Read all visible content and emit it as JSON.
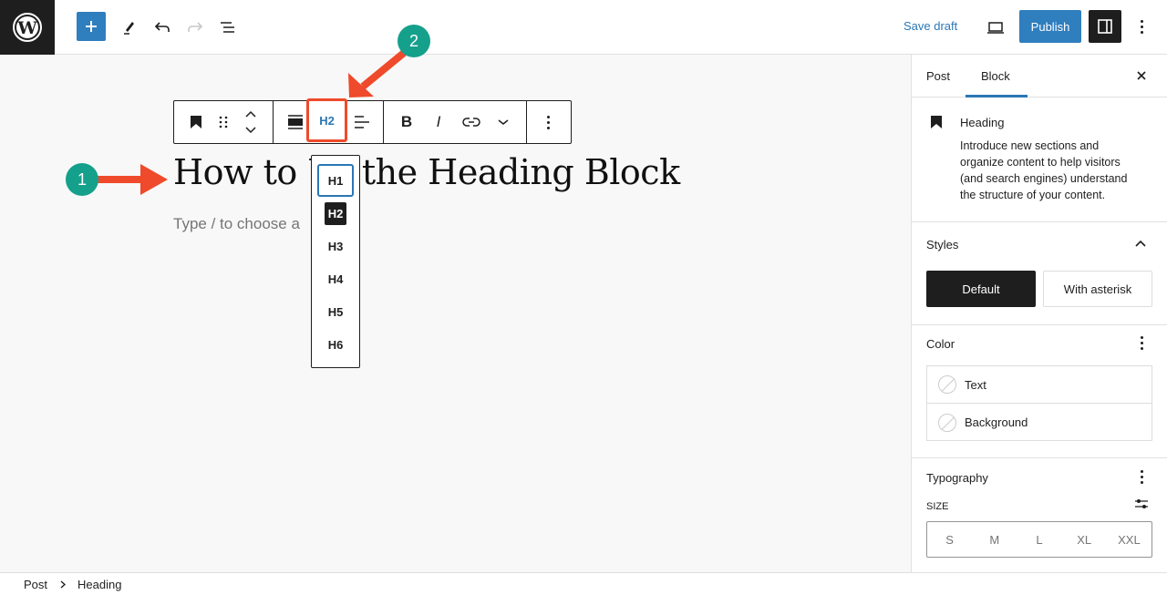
{
  "topbar": {
    "logo": "wordpress-logo",
    "add_block_label": "+",
    "save_draft": "Save draft",
    "publish": "Publish"
  },
  "block_toolbar": {
    "heading_level": "H2"
  },
  "editor": {
    "heading": "How to Use the Heading Block",
    "heading_visible_left": "How to U",
    "heading_visible_right": "the Heading Block",
    "placeholder": "Type / to choose a"
  },
  "heading_levels": [
    {
      "label": "H1",
      "state": "focused"
    },
    {
      "label": "H2",
      "state": "active"
    },
    {
      "label": "H3",
      "state": ""
    },
    {
      "label": "H4",
      "state": ""
    },
    {
      "label": "H5",
      "state": ""
    },
    {
      "label": "H6",
      "state": ""
    }
  ],
  "annotations": {
    "step1": "1",
    "step2": "2",
    "badge_color": "#15a08c",
    "arrow_color": "#ef4a2b"
  },
  "sidebar": {
    "tabs": [
      {
        "label": "Post",
        "active": false
      },
      {
        "label": "Block",
        "active": true
      }
    ],
    "block_card": {
      "title": "Heading",
      "description": "Introduce new sections and organize content to help visitors (and search engines) understand the structure of your content.",
      "desc_lines": [
        "Introduce new sections and",
        "organize content to help visitors",
        "(and search engines) understand",
        "the structure of your content."
      ]
    },
    "styles": {
      "title": "Styles",
      "options": [
        {
          "label": "Default",
          "selected": true
        },
        {
          "label": "With asterisk",
          "selected": false
        }
      ]
    },
    "color": {
      "title": "Color",
      "items": [
        "Text",
        "Background"
      ]
    },
    "typography": {
      "title": "Typography",
      "size_label": "SIZE",
      "sizes": [
        "S",
        "M",
        "L",
        "XL",
        "XXL"
      ]
    }
  },
  "footer": {
    "breadcrumb": [
      "Post",
      "Heading"
    ]
  },
  "colors": {
    "accent": "#2f7ebe",
    "dark": "#1e1e1e"
  }
}
